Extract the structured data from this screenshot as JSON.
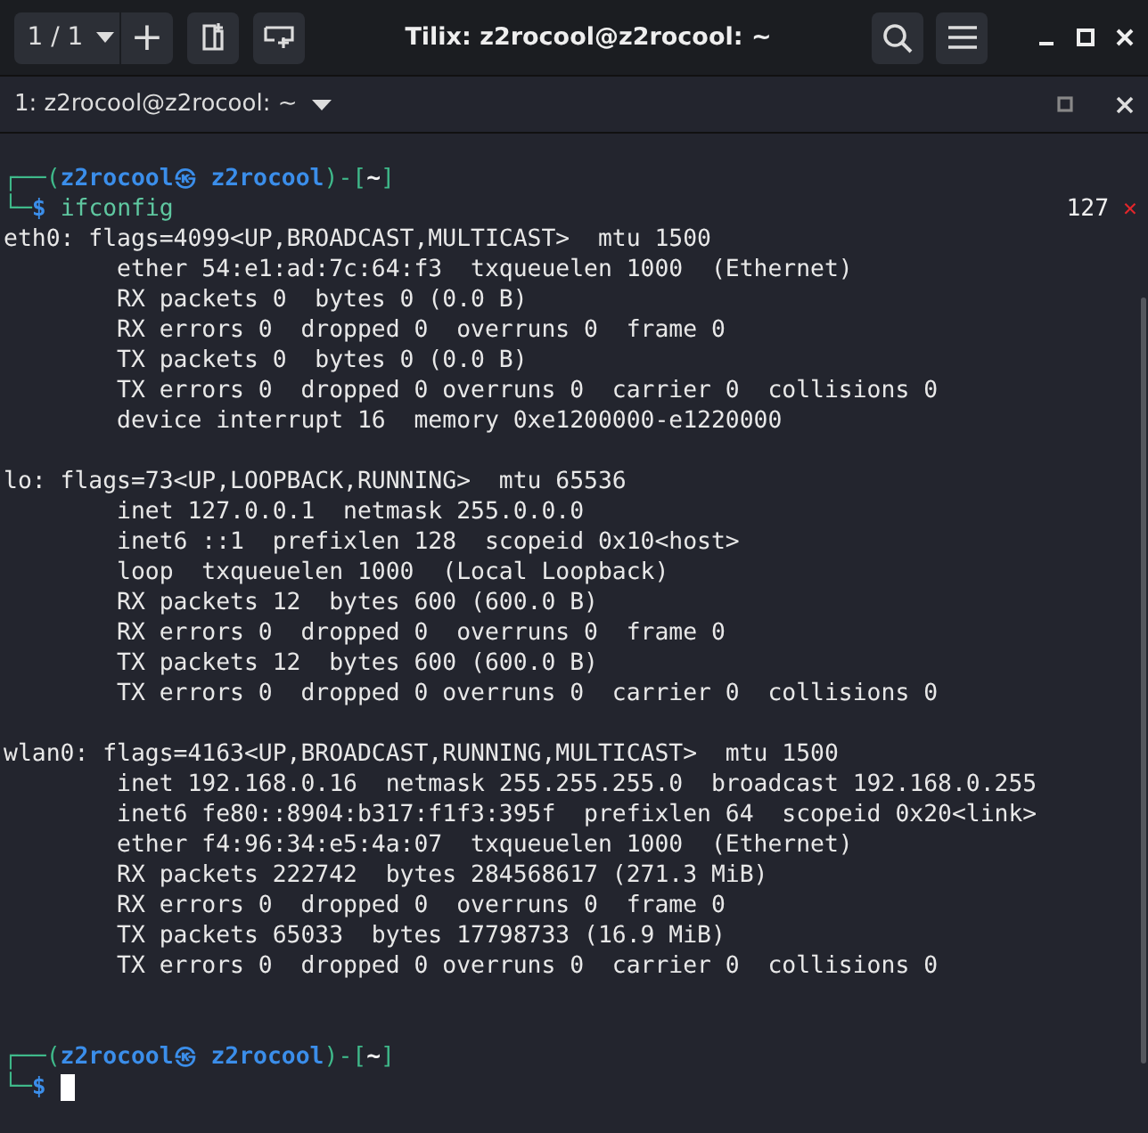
{
  "window": {
    "title": "Tilix: z2rocool@z2rocool: ~",
    "session_selector": "1 / 1",
    "new_session_button": "+"
  },
  "terminal_tab": {
    "title": "1: z2rocool@z2rocool: ~"
  },
  "prompt_1": {
    "segments": [
      {
        "kind": "frame",
        "text": "┌──("
      },
      {
        "kind": "user",
        "text": "z2rocool㉿ z2rocool"
      },
      {
        "kind": "frame",
        "text": ")-["
      },
      {
        "kind": "dir",
        "text": "~"
      },
      {
        "kind": "frame",
        "text": "]"
      }
    ],
    "corner": "└─",
    "symbol": "$",
    "command": "ifconfig",
    "exit_code": "127",
    "exit_mark": "✕"
  },
  "output": [
    {
      "lines": [
        "eth0: flags=4099<UP,BROADCAST,MULTICAST>  mtu 1500",
        "        ether 54:e1:ad:7c:64:f3  txqueuelen 1000  (Ethernet)",
        "        RX packets 0  bytes 0 (0.0 B)",
        "        RX errors 0  dropped 0  overruns 0  frame 0",
        "        TX packets 0  bytes 0 (0.0 B)",
        "        TX errors 0  dropped 0 overruns 0  carrier 0  collisions 0",
        "        device interrupt 16  memory 0xe1200000-e1220000"
      ]
    },
    {
      "lines": [
        "lo: flags=73<UP,LOOPBACK,RUNNING>  mtu 65536",
        "        inet 127.0.0.1  netmask 255.0.0.0",
        "        inet6 ::1  prefixlen 128  scopeid 0x10<host>",
        "        loop  txqueuelen 1000  (Local Loopback)",
        "        RX packets 12  bytes 600 (600.0 B)",
        "        RX errors 0  dropped 0  overruns 0  frame 0",
        "        TX packets 12  bytes 600 (600.0 B)",
        "        TX errors 0  dropped 0 overruns 0  carrier 0  collisions 0"
      ]
    },
    {
      "lines": [
        "wlan0: flags=4163<UP,BROADCAST,RUNNING,MULTICAST>  mtu 1500",
        "        inet 192.168.0.16  netmask 255.255.255.0  broadcast 192.168.0.255",
        "        inet6 fe80::8904:b317:f1f3:395f  prefixlen 64  scopeid 0x20<link>",
        "        ether f4:96:34:e5:4a:07  txqueuelen 1000  (Ethernet)",
        "        RX packets 222742  bytes 284568617 (271.3 MiB)",
        "        RX errors 0  dropped 0  overruns 0  frame 0",
        "        TX packets 65033  bytes 17798733 (16.9 MiB)",
        "        TX errors 0  dropped 0 overruns 0  carrier 0  collisions 0"
      ]
    }
  ],
  "prompt_2": {
    "segments": [
      {
        "kind": "frame",
        "text": "┌──("
      },
      {
        "kind": "user",
        "text": "z2rocool㉿ z2rocool"
      },
      {
        "kind": "frame",
        "text": ")-["
      },
      {
        "kind": "dir",
        "text": "~"
      },
      {
        "kind": "frame",
        "text": "]"
      }
    ],
    "corner": "└─",
    "symbol": "$"
  }
}
